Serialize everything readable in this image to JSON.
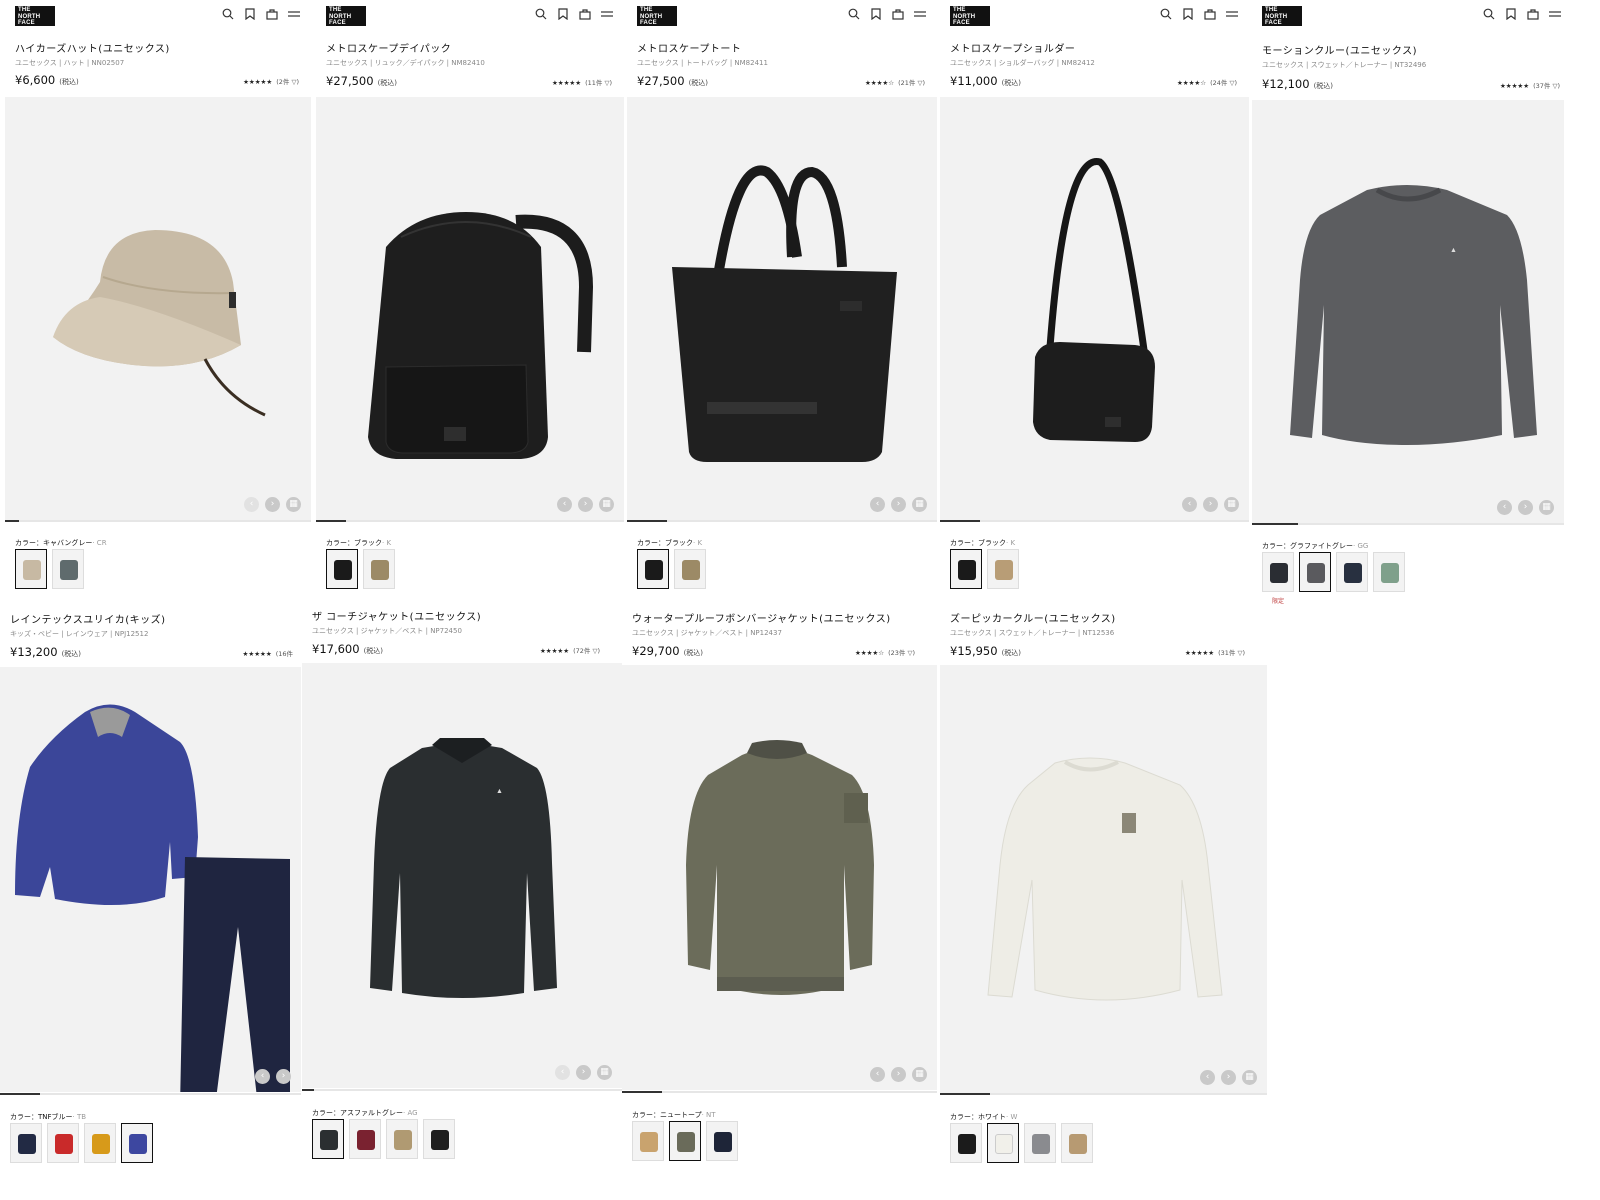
{
  "brand": {
    "logo_lines": [
      "THE",
      "NORTH",
      "FACE"
    ]
  },
  "header_icons": [
    "search-icon",
    "bookmark-icon",
    "cart-icon",
    "menu-icon"
  ],
  "products": [
    {
      "id": "p1",
      "name": "ハイカーズハット(ユニセックス)",
      "meta": "ユニセックス | ハット | NN02507",
      "price": "¥6,600",
      "tax": "(税込)",
      "stars": "★★★★★",
      "reviews": "(2件 ▽)",
      "color_label": "カラー：キャバングレー",
      "color_code": "· CR",
      "swatches": [
        "#c7b9a3",
        "#5f6b6d"
      ]
    },
    {
      "id": "p2",
      "name": "メトロスケープデイパック",
      "meta": "ユニセックス | リュック／デイパック | NM82410",
      "price": "¥27,500",
      "tax": "(税込)",
      "stars": "★★★★★",
      "reviews": "(11件 ▽)",
      "color_label": "カラー：ブラック",
      "color_code": "· K",
      "swatches": [
        "#1a1a1a",
        "#9c8a66"
      ]
    },
    {
      "id": "p3",
      "name": "メトロスケープトート",
      "meta": "ユニセックス | トートバッグ | NM82411",
      "price": "¥27,500",
      "tax": "(税込)",
      "stars": "★★★★☆",
      "reviews": "(21件 ▽)",
      "color_label": "カラー：ブラック",
      "color_code": "· K",
      "swatches": [
        "#1a1a1a",
        "#9c8a66"
      ]
    },
    {
      "id": "p4",
      "name": "メトロスケープショルダー",
      "meta": "ユニセックス | ショルダーバッグ | NM82412",
      "price": "¥11,000",
      "tax": "(税込)",
      "stars": "★★★★☆",
      "reviews": "(24件 ▽)",
      "color_label": "カラー：ブラック",
      "color_code": "· K",
      "swatches": [
        "#1a1a1a",
        "#b89d76"
      ]
    },
    {
      "id": "p5",
      "name": "モーションクルー(ユニセックス)",
      "meta": "ユニセックス | スウェット／トレーナー | NT32496",
      "price": "¥12,100",
      "tax": "(税込)",
      "stars": "★★★★★",
      "reviews": "(37件 ▽)",
      "color_label": "カラー：グラファイトグレー",
      "color_code": "· GG",
      "swatches": [
        "#2a2d33",
        "#5a5a5e",
        "#283040",
        "#7fa08b"
      ],
      "swatch_note": "限定"
    },
    {
      "id": "p6",
      "name": "レインテックスユリイカ(キッズ)",
      "meta": "キッズ・ベビー | レインウェア | NPJ12512",
      "price": "¥13,200",
      "tax": "(税込)",
      "stars": "★★★★★",
      "reviews": "(16件",
      "color_label": "カラー：TNFブルー",
      "color_code": "· TB",
      "swatches": [
        "#222a44",
        "#c92a2a",
        "#d79a1a",
        "#3d47a0"
      ]
    },
    {
      "id": "p7",
      "name": "ザ コーチジャケット(ユニセックス)",
      "meta": "ユニセックス | ジャケット／ベスト | NP72450",
      "price": "¥17,600",
      "tax": "(税込)",
      "stars": "★★★★★",
      "reviews": "(72件 ▽)",
      "color_label": "カラー：アスファルトグレー",
      "color_code": "· AG",
      "swatches": [
        "#2b2f31",
        "#7a2230",
        "#b09a72",
        "#1f1f1f"
      ]
    },
    {
      "id": "p8",
      "name": "ウォータープルーフボンバージャケット(ユニセックス)",
      "meta": "ユニセックス | ジャケット／ベスト | NP12437",
      "price": "¥29,700",
      "tax": "(税込)",
      "stars": "★★★★☆",
      "reviews": "(23件 ▽)",
      "color_label": "カラー：ニュートープ",
      "color_code": "· NT",
      "swatches": [
        "#c9a36e",
        "#6a6b5a",
        "#1e2538"
      ]
    },
    {
      "id": "p9",
      "name": "ズーピッカークルー(ユニセックス)",
      "meta": "ユニセックス | スウェット／トレーナー | NT12536",
      "price": "¥15,950",
      "tax": "(税込)",
      "stars": "★★★★★",
      "reviews": "(31件 ▽)",
      "color_label": "カラー：ホワイト",
      "color_code": "· W",
      "swatches": [
        "#1b1b1b",
        "#f1f0ea",
        "#8a8b8f",
        "#b79a72"
      ]
    }
  ],
  "carousel": {
    "prev": "‹",
    "next": "›",
    "grid": "▦"
  }
}
